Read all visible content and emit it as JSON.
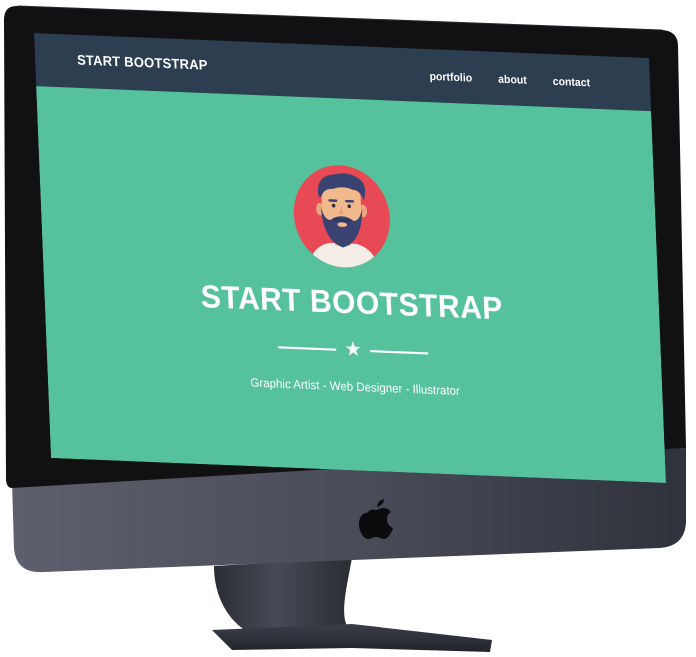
{
  "navbar": {
    "brand": "START BOOTSTRAP",
    "links": [
      {
        "label": "portfolio"
      },
      {
        "label": "about"
      },
      {
        "label": "contact"
      }
    ]
  },
  "hero": {
    "avatar_icon": "bearded-man-avatar-icon",
    "title": "START BOOTSTRAP",
    "divider_icon": "star-icon",
    "subtitle": "Graphic Artist - Web Designer - Illustrator"
  },
  "device": {
    "logo_icon": "apple-logo-icon"
  },
  "colors": {
    "navbar_bg": "#2c3e50",
    "hero_bg": "#55c29d",
    "avatar_bg": "#e84a55",
    "device_frame": "#111114",
    "device_chin": "#4a4d5a",
    "stand": "#3a3d48"
  }
}
